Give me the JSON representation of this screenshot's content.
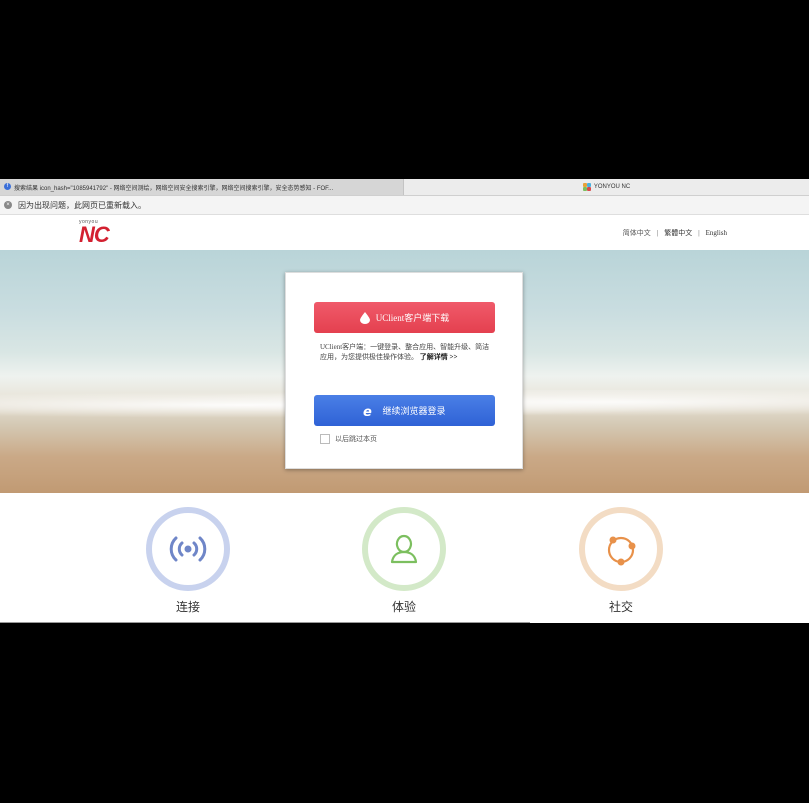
{
  "tabs": [
    {
      "label": "搜索结果 icon_hash=\"1085941792\" - 网络空间测绘，网络空间安全搜索引擎，网络空间搜索引擎，安全态势感知 - FOF...",
      "icon": "fofa-favicon"
    },
    {
      "label": "YONYOU NC",
      "icon": "yonyou-favicon"
    }
  ],
  "infobar": {
    "message": "因为出现问题，此网页已重新载入。",
    "icon": "close-icon"
  },
  "header": {
    "logo_small": "yonyou",
    "logo_big": "NC",
    "languages": [
      "简体中文",
      "繁體中文",
      "English"
    ],
    "separator": "|"
  },
  "card": {
    "download_button": "UClient客户端下载",
    "description": "UClient客户端：一键登录、整合应用、智能升级、简洁应用，为您提供极佳操作体验。",
    "more_link": "了解详情 >>",
    "browser_button": "继续浏览器登录",
    "skip_label": "以后跳过本页"
  },
  "features": [
    {
      "label": "连接",
      "icon": "wifi-signal-icon",
      "color": "#6f86c8"
    },
    {
      "label": "体验",
      "icon": "user-icon",
      "color": "#7cbf5f"
    },
    {
      "label": "社交",
      "icon": "share-network-icon",
      "color": "#e8914a"
    }
  ],
  "colors": {
    "brand_red": "#d32030",
    "button_red": "#e4404f",
    "button_blue": "#2f62d6"
  }
}
